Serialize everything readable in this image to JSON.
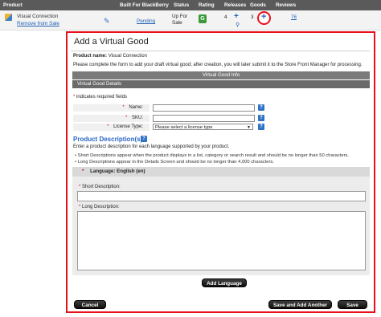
{
  "table": {
    "headers": {
      "product": "Product",
      "built_for": "Built For BlackBerry",
      "status": "Status",
      "rating": "Rating",
      "releases": "Releases",
      "goods": "Goods",
      "reviews": "Reviews"
    },
    "row": {
      "name": "Visual Connection",
      "remove_link": "Remove from Sale",
      "status": "Pending",
      "up_for_sale": "Up For Sale",
      "rating": "G",
      "releases_count": "4",
      "goods_count": "3",
      "reviews": "76"
    }
  },
  "dialog": {
    "title": "Add a Virtual Good",
    "product_name_label": "Product name:",
    "product_name_value": "Visual Connection",
    "intro": "Please complete the form to add your draft virtual good; after creation, you will later submit it to the Store Front Manager for processing.",
    "band_info": "Virtual Good Info",
    "band_details": "Virtual Good Details",
    "required_note": "indicates required fields",
    "required_mark": "*",
    "fields": {
      "name_label": "Name:",
      "sku_label": "SKU:",
      "license_label": "License Type:",
      "license_selected": "Please select a license type"
    },
    "product_desc": {
      "title": "Product Description(s)",
      "subtitle": "Enter a product description for each language supported by your product.",
      "bullet1": "Short Descriptions appear when the product displays in a list, category or search result and should be no longer than 50 characters.",
      "bullet2": "Long Descriptions appear in the Details Screen and should be no longer than 4,000 characters.",
      "language_header": "Language: English (en)",
      "short_label": "Short Description:",
      "long_label": "Long Description:"
    },
    "buttons": {
      "add_language": "Add Language",
      "cancel": "Cancel",
      "save_add_another": "Save and Add Another",
      "save": "Save"
    }
  },
  "colors": {
    "highlight_red": "#e8101c",
    "link_blue": "#1f61b8",
    "header_gray": "#5a5a5a"
  }
}
